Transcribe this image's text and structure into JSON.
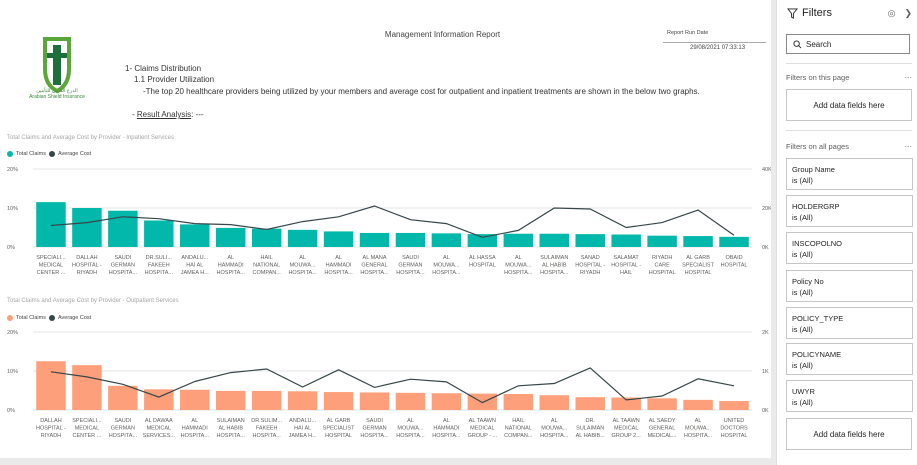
{
  "report": {
    "logo_text": "الدرع العربي للتأمين\nArabian Shield Insurance",
    "title": "Management Information Report",
    "run_date_label": "Report Run Date",
    "run_date_value": "29/08/2021 07:33:13",
    "section": "1- Claims Distribution",
    "subsection": "1.1 Provider Utilization",
    "description": "-The top 20 healthcare providers being utilized by your members and average cost for outpatient and inpatient treatments are shown in the below two graphs.",
    "result_prefix": "- ",
    "result_link": "Result Analysis",
    "result_suffix": ": ---"
  },
  "charts": [
    {
      "title": "Total Claims and Average Cost by Provider - Inpatient Services",
      "legend": [
        "Total Claims",
        "Average Cost"
      ]
    },
    {
      "title": "Total Claims and Average Cost by Provider - Outpatient Services",
      "legend": [
        "Total Claims",
        "Average Cost"
      ]
    }
  ],
  "chart_data": [
    {
      "type": "bar",
      "title": "Total Claims and Average Cost by Provider - Inpatient Services",
      "bar_color": "#01b8aa",
      "line_color": "#374649",
      "categories": [
        [
          "SPECIALI...",
          "MEDICAL",
          "CENTER ..."
        ],
        [
          "DALLAH",
          "HOSPITAL -",
          "RIYADH"
        ],
        [
          "SAUDI",
          "GERMAN",
          "HOSPITA..."
        ],
        [
          "DR.SULI...",
          "FAKEEH",
          "HOSPITA..."
        ],
        [
          "ANDALU...",
          "HAI AL",
          "JAMEA H..."
        ],
        [
          "AL",
          "HAMMADI",
          "HOSPITA..."
        ],
        [
          "HAIL",
          "NATIONAL",
          "COMPAN..."
        ],
        [
          "AL",
          "MOUWA...",
          "HOSPITA..."
        ],
        [
          "AL",
          "HAMMADI",
          "HOSPITA..."
        ],
        [
          "AL MANA",
          "GENERAL",
          "HOSPITA..."
        ],
        [
          "SAUDI",
          "GERMAN",
          "HOSPITA..."
        ],
        [
          "AL",
          "MOUWA...",
          "HOSPITA..."
        ],
        [
          "AL HASSA",
          "HOSPITAL"
        ],
        [
          "AL",
          "MOUWA...",
          "HOSPITA..."
        ],
        [
          "SULAIMAN",
          "AL HABIB",
          "HOSPITA..."
        ],
        [
          "SANAD",
          "HOSPITAL -",
          "RIYADH"
        ],
        [
          "SALAMAT",
          "HOSPITAL -",
          "HAIL"
        ],
        [
          "RIYADH",
          "CARE",
          "HOSPITAL"
        ],
        [
          "AL GARB",
          "SPECIALIST",
          "HOSPITAL"
        ],
        [
          "OBAID",
          "HOSPITAL"
        ]
      ],
      "series": [
        {
          "name": "Total Claims",
          "axis": "left",
          "unit": "%",
          "values": [
            11.5,
            10,
            9.3,
            6.8,
            5.8,
            4.9,
            4.7,
            4.4,
            4.0,
            3.6,
            3.6,
            3.5,
            3.3,
            3.4,
            3.4,
            3.3,
            3.2,
            2.9,
            2.8,
            2.6
          ]
        },
        {
          "name": "Average Cost",
          "axis": "right",
          "values": [
            11000,
            12500,
            15500,
            14500,
            12000,
            11500,
            9000,
            13000,
            15500,
            21000,
            14000,
            12000,
            5000,
            8500,
            20000,
            19500,
            10000,
            12500,
            19000,
            6000
          ]
        }
      ],
      "ylim_left": [
        0,
        20
      ],
      "yticks_left": [
        "0%",
        "10%",
        "20%"
      ],
      "ylim_right": [
        0,
        40000
      ],
      "yticks_right": [
        "0K",
        "20K",
        "40K"
      ]
    },
    {
      "type": "bar",
      "title": "Total Claims and Average Cost by Provider - Outpatient Services",
      "bar_color": "#fd9f7b",
      "line_color": "#374649",
      "categories": [
        [
          "DALLAH",
          "HOSPITAL -",
          "RIYADH"
        ],
        [
          "SPECIALI...",
          "MEDICAL",
          "CENTER ..."
        ],
        [
          "SAUDI",
          "GERMAN",
          "HOSPITA..."
        ],
        [
          "AL DAWAA",
          "MEDICAL",
          "SERVICES..."
        ],
        [
          "AL",
          "HAMMADI",
          "HOSPITA..."
        ],
        [
          "SULAIMAN",
          "AL HABIB",
          "HOSPITA..."
        ],
        [
          "DR.SULIM...",
          "FAKEEH",
          "HOSPITA..."
        ],
        [
          "ANDALU...",
          "HAI AL",
          "JAMEA H..."
        ],
        [
          "AL GARB",
          "SPECIALIST",
          "HOSPITAL"
        ],
        [
          "SAUDI",
          "GERMAN",
          "HOSPITA..."
        ],
        [
          "AL",
          "MOUWA...",
          "HOSPITA..."
        ],
        [
          "AL",
          "HAMMADI",
          "HOSPITA..."
        ],
        [
          "AL TAAWN",
          "MEDICAL",
          "GROUP - ..."
        ],
        [
          "HAIL",
          "NATIONAL",
          "COMPAN..."
        ],
        [
          "AL",
          "MOUWA...",
          "HOSPITA..."
        ],
        [
          "DR.",
          "SULAIMAN",
          "AL HABIB..."
        ],
        [
          "AL TAAWN",
          "MEDICAL",
          "GROUP 2..."
        ],
        [
          "AL SAEDY",
          "GENERAL",
          "MEDICAL..."
        ],
        [
          "AL",
          "MOUWA...",
          "HOSPITA..."
        ],
        [
          "UNITED",
          "DOCTORS",
          "HOSPITAL"
        ]
      ],
      "series": [
        {
          "name": "Total Claims",
          "axis": "left",
          "unit": "%",
          "values": [
            12.5,
            11.5,
            6.2,
            5.3,
            5.2,
            4.9,
            4.9,
            4.8,
            4.6,
            4.5,
            4.4,
            4.3,
            4.2,
            4.1,
            3.8,
            3.3,
            3.2,
            3.0,
            2.6,
            2.3
          ]
        },
        {
          "name": "Average Cost",
          "axis": "right",
          "values": [
            980,
            850,
            660,
            330,
            730,
            960,
            1050,
            590,
            1030,
            580,
            790,
            720,
            190,
            620,
            680,
            1080,
            260,
            360,
            800,
            620
          ]
        }
      ],
      "ylim_left": [
        0,
        20
      ],
      "yticks_left": [
        "0%",
        "10%",
        "20%"
      ],
      "ylim_right": [
        0,
        2000
      ],
      "yticks_right": [
        "0K",
        "1K",
        "2K"
      ]
    }
  ],
  "filters": {
    "title": "Filters",
    "search_placeholder": "Search",
    "on_this_page_label": "Filters on this page",
    "on_all_pages_label": "Filters on all pages",
    "add_data_label": "Add data fields here",
    "more_label": "...",
    "cards": [
      {
        "name": "Group Name",
        "value": "is (All)"
      },
      {
        "name": "HOLDERGRP",
        "value": "is (All)"
      },
      {
        "name": "INSCOPOLNO",
        "value": "is (All)"
      },
      {
        "name": "Policy No",
        "value": "is (All)"
      },
      {
        "name": "POLICY_TYPE",
        "value": "is (All)"
      },
      {
        "name": "POLICYNAME",
        "value": "is (All)"
      },
      {
        "name": "UWYR",
        "value": "is (All)"
      }
    ]
  }
}
